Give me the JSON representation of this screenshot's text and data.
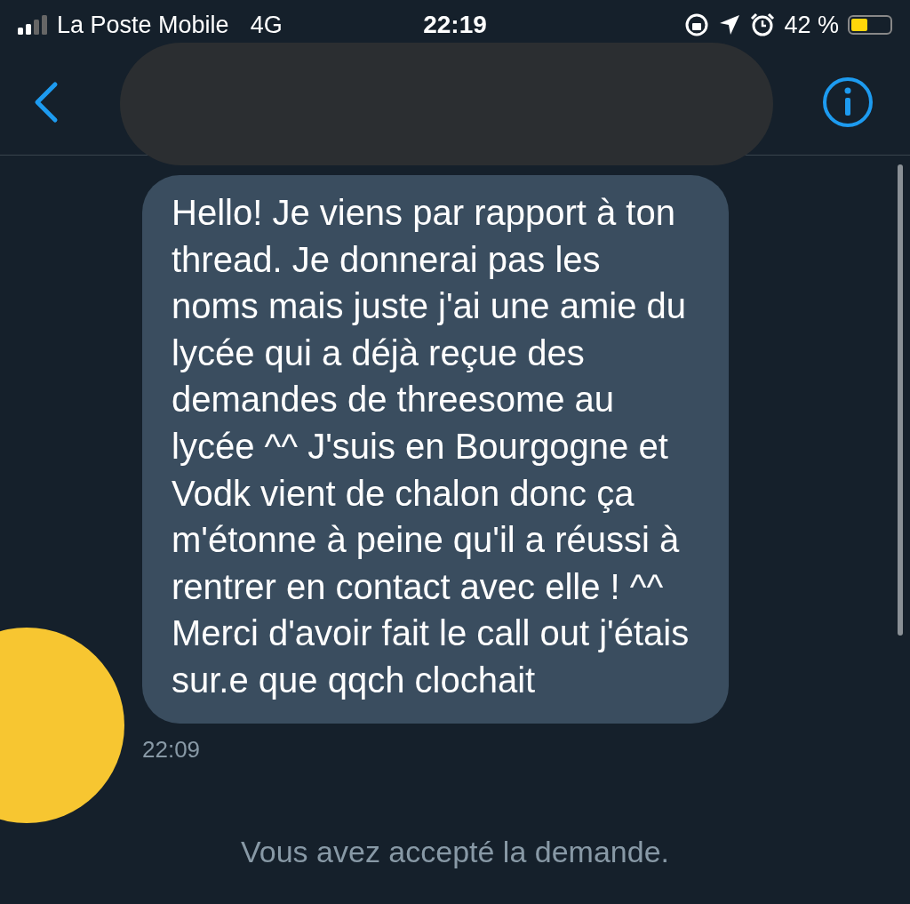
{
  "status_bar": {
    "carrier": "La Poste Mobile",
    "network": "4G",
    "time": "22:19",
    "battery_text": "42 %"
  },
  "messages": [
    {
      "text": "Hello! Je viens par rapport à ton thread. Je donnerai pas les noms mais juste j'ai une amie du lycée qui a déjà reçue des demandes de threesome au lycée ^^ J'suis en Bourgogne et Vodk vient de chalon donc ça m'étonne à peine qu'il a réussi à rentrer en contact avec elle ! ^^ Merci d'avoir fait le call out j'étais sur.e que qqch clochait",
      "time": "22:09"
    }
  ],
  "notice": "Vous avez accepté la demande."
}
